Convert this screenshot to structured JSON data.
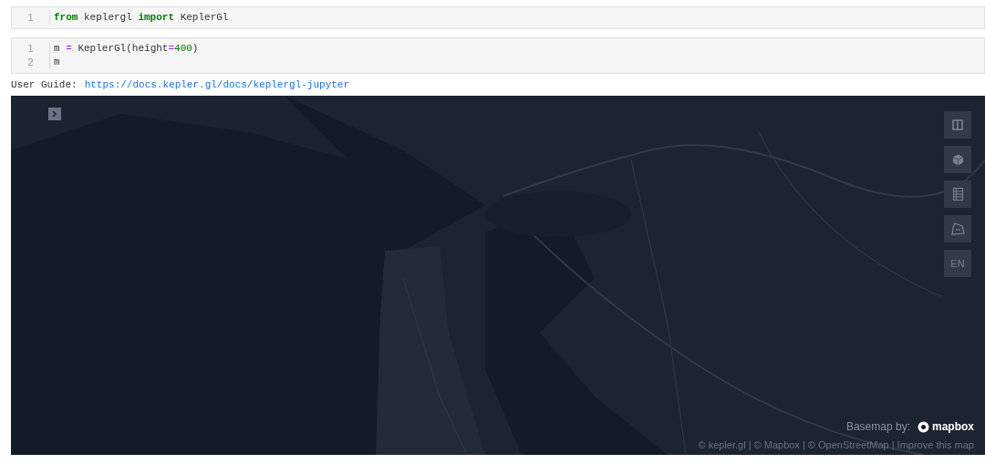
{
  "cells": [
    {
      "lines": [
        {
          "number": "1",
          "tokens": [
            {
              "kind": "keyword",
              "text": "from"
            },
            {
              "kind": "plain",
              "text": " keplergl "
            },
            {
              "kind": "keyword",
              "text": "import"
            },
            {
              "kind": "plain",
              "text": " KeplerGl"
            }
          ]
        }
      ]
    },
    {
      "lines": [
        {
          "number": "1",
          "tokens": [
            {
              "kind": "plain",
              "text": "m "
            },
            {
              "kind": "operator",
              "text": "="
            },
            {
              "kind": "plain",
              "text": " KeplerGl(height"
            },
            {
              "kind": "operator",
              "text": "="
            },
            {
              "kind": "number",
              "text": "400"
            },
            {
              "kind": "plain",
              "text": ")"
            }
          ]
        },
        {
          "number": "2",
          "tokens": [
            {
              "kind": "plain",
              "text": "m"
            }
          ]
        }
      ]
    }
  ],
  "output": {
    "label": "User Guide:",
    "link": "https://docs.kepler.gl/docs/keplergl-jupyter"
  },
  "map": {
    "side_panel_toggle": {
      "expanded": false
    },
    "controls": [
      {
        "kind": "split"
      },
      {
        "kind": "cube"
      },
      {
        "kind": "legend"
      },
      {
        "kind": "draw"
      },
      {
        "kind": "locale",
        "text": "EN"
      }
    ],
    "basemap": {
      "label": "Basemap by:",
      "logo": "mapbox"
    },
    "attribution": "© kepler.gl | © Mapbox | © OpenStreetMap | Improve this map"
  }
}
